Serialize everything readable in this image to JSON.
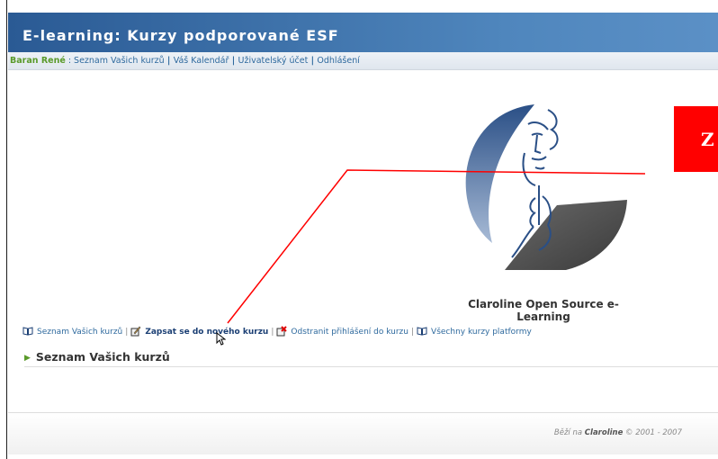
{
  "banner": {
    "title": "E-learning: Kurzy podporované ESF"
  },
  "userbar": {
    "user_name": "Baran René",
    "separator_colon": " : ",
    "links": [
      "Seznam Vašich kurzů",
      "Váš Kalendář",
      "Uživatelský účet",
      "Odhlášení"
    ],
    "sep": " | "
  },
  "logo": {
    "caption": "Claroline Open Source e-Learning"
  },
  "redbox": {
    "text": "Z",
    "color": "#ff0000"
  },
  "toolbar": {
    "items": [
      {
        "label": "Seznam Vašich kurzů",
        "icon": "book-icon"
      },
      {
        "label": "Zapsat se do nového kurzu",
        "icon": "enroll-icon"
      },
      {
        "label": "Odstranit přihlášení do kurzu",
        "icon": "unenroll-icon"
      },
      {
        "label": "Všechny kurzy platformy",
        "icon": "book-icon"
      }
    ],
    "sep": "|"
  },
  "section": {
    "title": "Seznam Vašich kurzů"
  },
  "footer": {
    "prefix": "Běží na ",
    "brand": "Claroline",
    "suffix": " © 2001 - 2007"
  },
  "colors": {
    "banner": "#3f73ab",
    "user_name": "#5a9a2a",
    "link": "#2f6a9e",
    "annotation": "#ff0000"
  }
}
